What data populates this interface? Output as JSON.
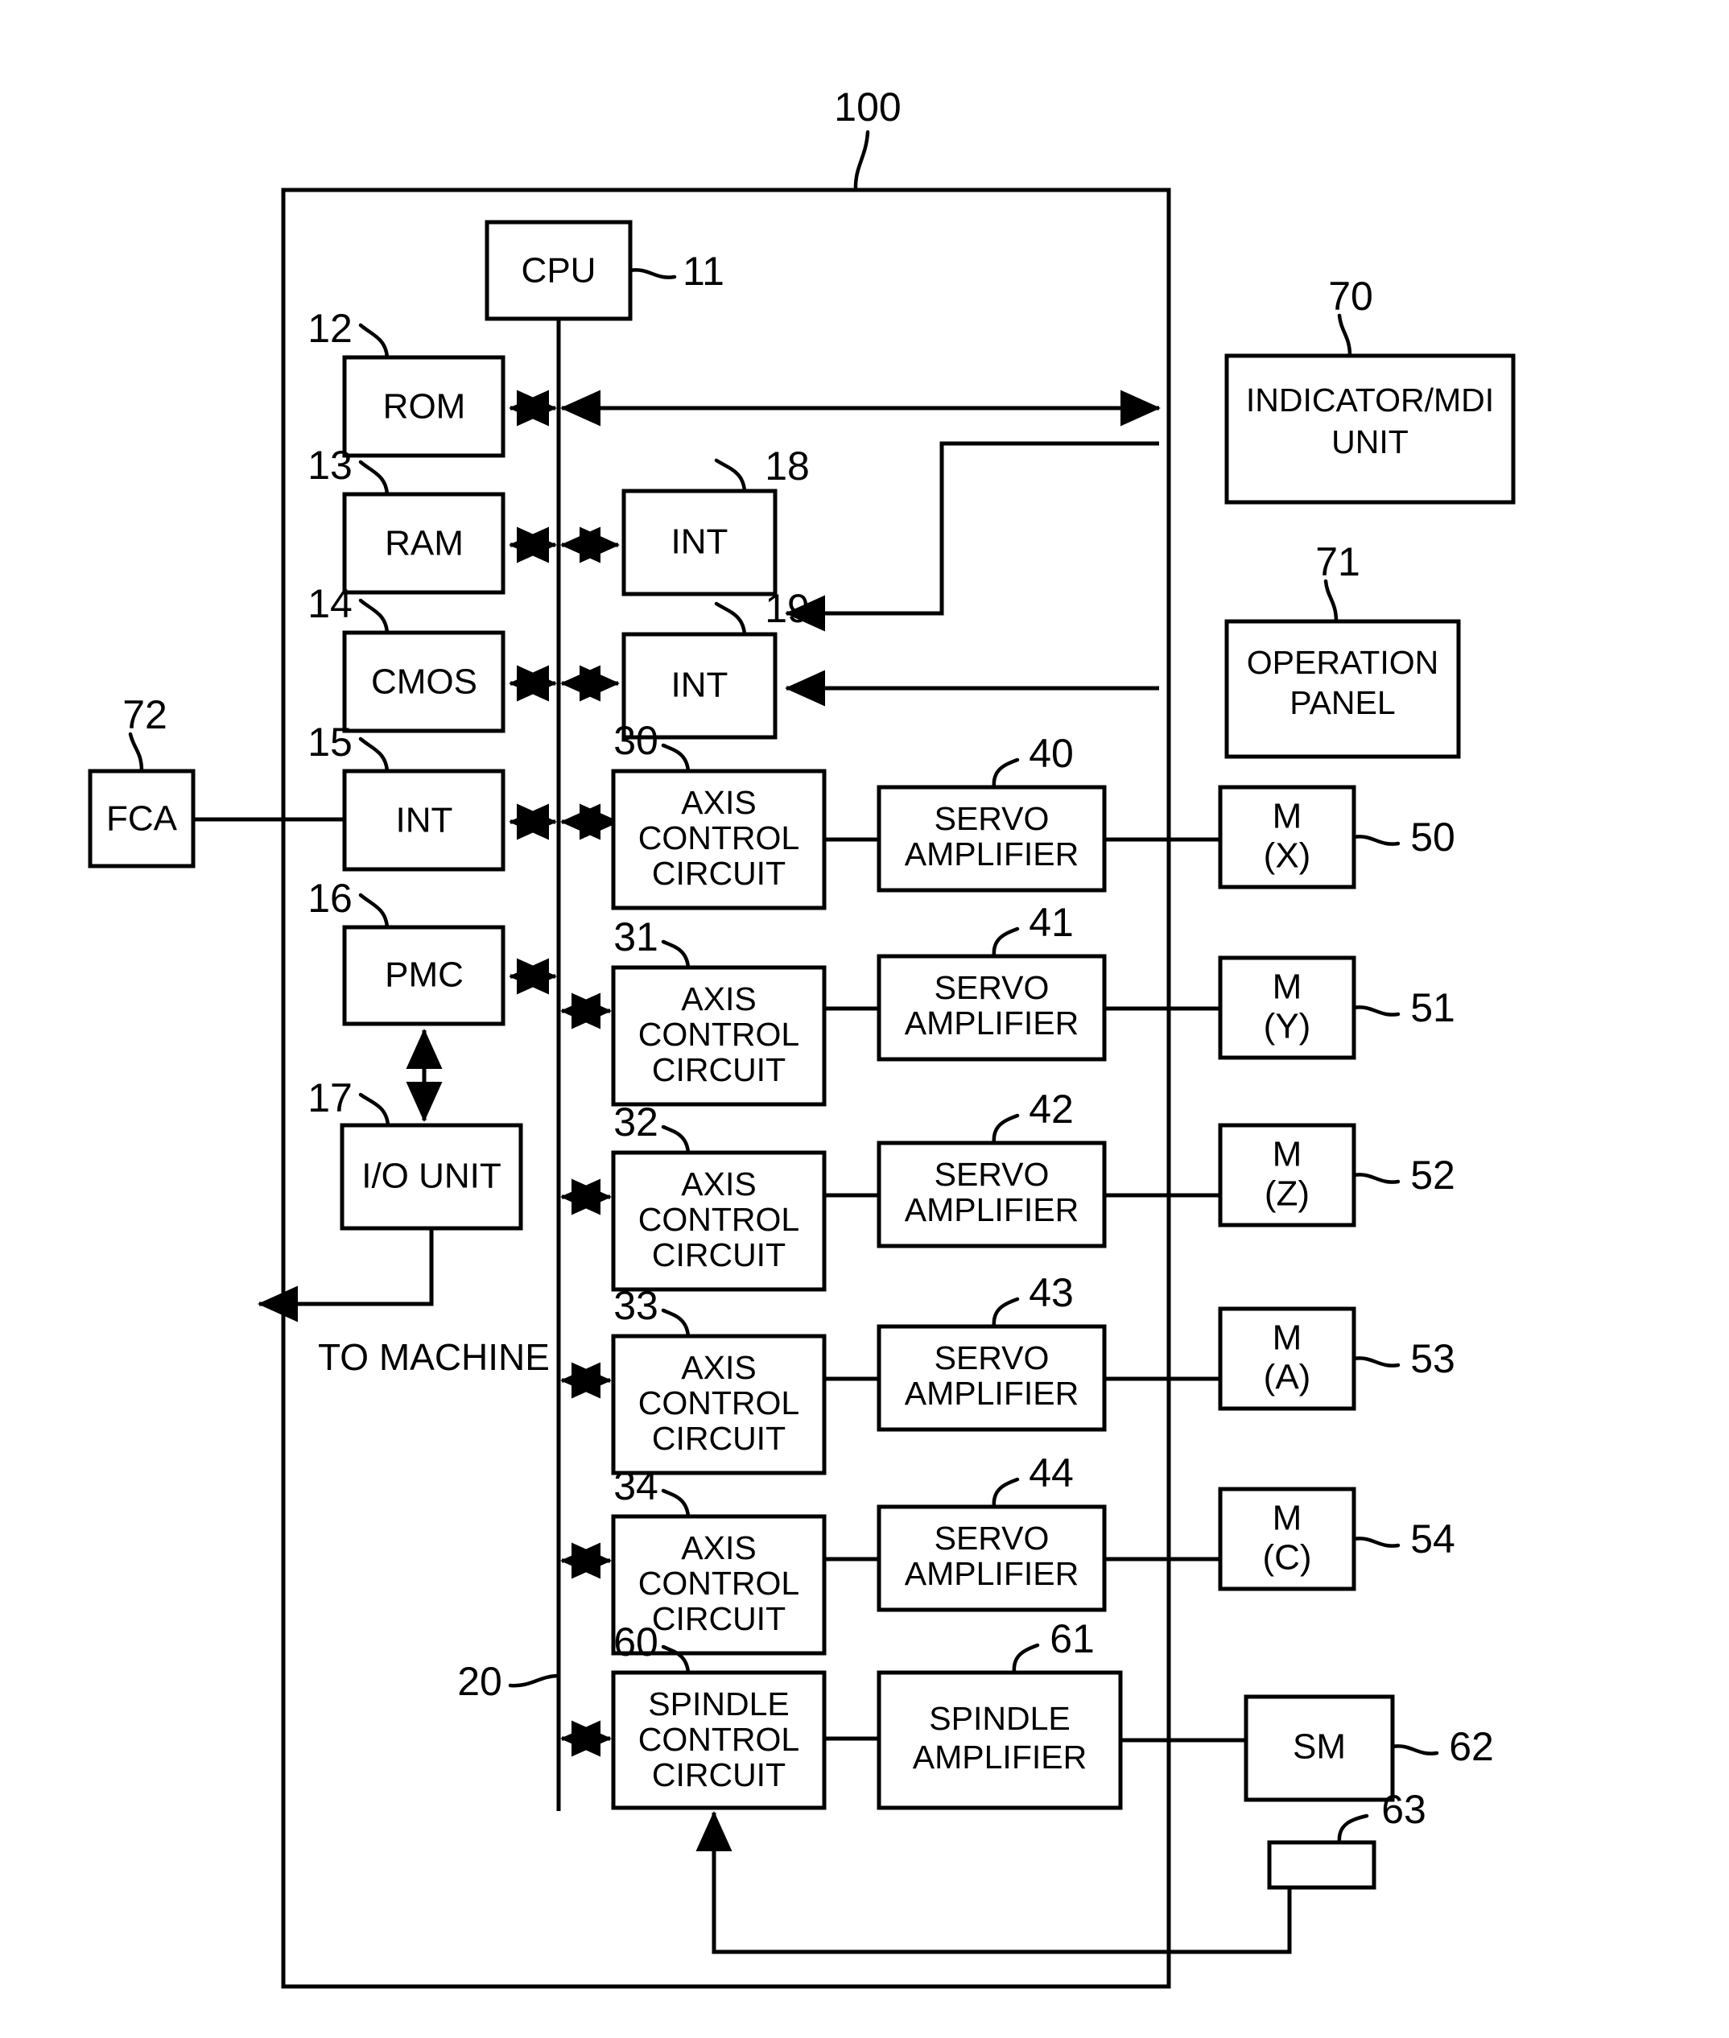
{
  "diagram": {
    "title_ref": "100",
    "bus_ref": "20",
    "free_text": {
      "to_machine": "TO MACHINE"
    },
    "outer_frame": {
      "ref": "100"
    },
    "blocks": [
      {
        "id": "cpu",
        "label": "CPU",
        "ref": "11"
      },
      {
        "id": "rom",
        "label": "ROM",
        "ref": "12"
      },
      {
        "id": "ram",
        "label": "RAM",
        "ref": "13"
      },
      {
        "id": "cmos",
        "label": "CMOS",
        "ref": "14"
      },
      {
        "id": "int15",
        "label": "INT",
        "ref": "15"
      },
      {
        "id": "pmc",
        "label": "PMC",
        "ref": "16"
      },
      {
        "id": "io_unit",
        "label": "I/O UNIT",
        "ref": "17"
      },
      {
        "id": "int18",
        "label": "INT",
        "ref": "18"
      },
      {
        "id": "int19",
        "label": "INT",
        "ref": "19"
      },
      {
        "id": "axis30",
        "label": "AXIS CONTROL CIRCUIT",
        "ref": "30"
      },
      {
        "id": "axis31",
        "label": "AXIS CONTROL CIRCUIT",
        "ref": "31"
      },
      {
        "id": "axis32",
        "label": "AXIS CONTROL CIRCUIT",
        "ref": "32"
      },
      {
        "id": "axis33",
        "label": "AXIS CONTROL CIRCUIT",
        "ref": "33"
      },
      {
        "id": "axis34",
        "label": "AXIS CONTROL CIRCUIT",
        "ref": "34"
      },
      {
        "id": "servo40",
        "label": "SERVO AMPLIFIER",
        "ref": "40"
      },
      {
        "id": "servo41",
        "label": "SERVO AMPLIFIER",
        "ref": "41"
      },
      {
        "id": "servo42",
        "label": "SERVO AMPLIFIER",
        "ref": "42"
      },
      {
        "id": "servo43",
        "label": "SERVO AMPLIFIER",
        "ref": "43"
      },
      {
        "id": "servo44",
        "label": "SERVO AMPLIFIER",
        "ref": "44"
      },
      {
        "id": "motor50",
        "label": "M (X)",
        "ref": "50"
      },
      {
        "id": "motor51",
        "label": "M (Y)",
        "ref": "51"
      },
      {
        "id": "motor52",
        "label": "M (Z)",
        "ref": "52"
      },
      {
        "id": "motor53",
        "label": "M (A)",
        "ref": "53"
      },
      {
        "id": "motor54",
        "label": "M (C)",
        "ref": "54"
      },
      {
        "id": "spindle60",
        "label": "SPINDLE CONTROL CIRCUIT",
        "ref": "60"
      },
      {
        "id": "spindle61",
        "label": "SPINDLE AMPLIFIER",
        "ref": "61"
      },
      {
        "id": "sm62",
        "label": "SM",
        "ref": "62"
      },
      {
        "id": "pg63",
        "label": "",
        "ref": "63"
      },
      {
        "id": "indicator70",
        "label": "INDICATOR/MDI UNIT",
        "ref": "70"
      },
      {
        "id": "oppanel71",
        "label": "OPERATION PANEL",
        "ref": "71"
      },
      {
        "id": "fca72",
        "label": "FCA",
        "ref": "72"
      }
    ],
    "text": {
      "cpu": "CPU",
      "rom": "ROM",
      "ram": "RAM",
      "cmos": "CMOS",
      "int15": "INT",
      "pmc": "PMC",
      "io_unit": "I/O UNIT",
      "int18": "INT",
      "int19": "INT",
      "axis_l1": "AXIS",
      "axis_l2": "CONTROL",
      "axis_l3": "CIRCUIT",
      "servo_l1": "SERVO",
      "servo_l2": "AMPLIFIER",
      "spindle_l1": "SPINDLE",
      "spindle_l2": "CONTROL",
      "spindle_l3": "CIRCUIT",
      "spamp_l1": "SPINDLE",
      "spamp_l2": "AMPLIFIER",
      "m": "M",
      "mx": "(X)",
      "my": "(Y)",
      "mz": "(Z)",
      "ma": "(A)",
      "mc": "(C)",
      "sm": "SM",
      "ind_l1": "INDICATOR/MDI",
      "ind_l2": "UNIT",
      "op_l1": "OPERATION",
      "op_l2": "PANEL",
      "fca": "FCA",
      "to_machine": "TO MACHINE"
    },
    "refs": {
      "r100": "100",
      "r11": "11",
      "r12": "12",
      "r13": "13",
      "r14": "14",
      "r15": "15",
      "r16": "16",
      "r17": "17",
      "r18": "18",
      "r19": "19",
      "r20": "20",
      "r30": "30",
      "r31": "31",
      "r32": "32",
      "r33": "33",
      "r34": "34",
      "r40": "40",
      "r41": "41",
      "r42": "42",
      "r43": "43",
      "r44": "44",
      "r50": "50",
      "r51": "51",
      "r52": "52",
      "r53": "53",
      "r54": "54",
      "r60": "60",
      "r61": "61",
      "r62": "62",
      "r63": "63",
      "r70": "70",
      "r71": "71",
      "r72": "72"
    }
  }
}
